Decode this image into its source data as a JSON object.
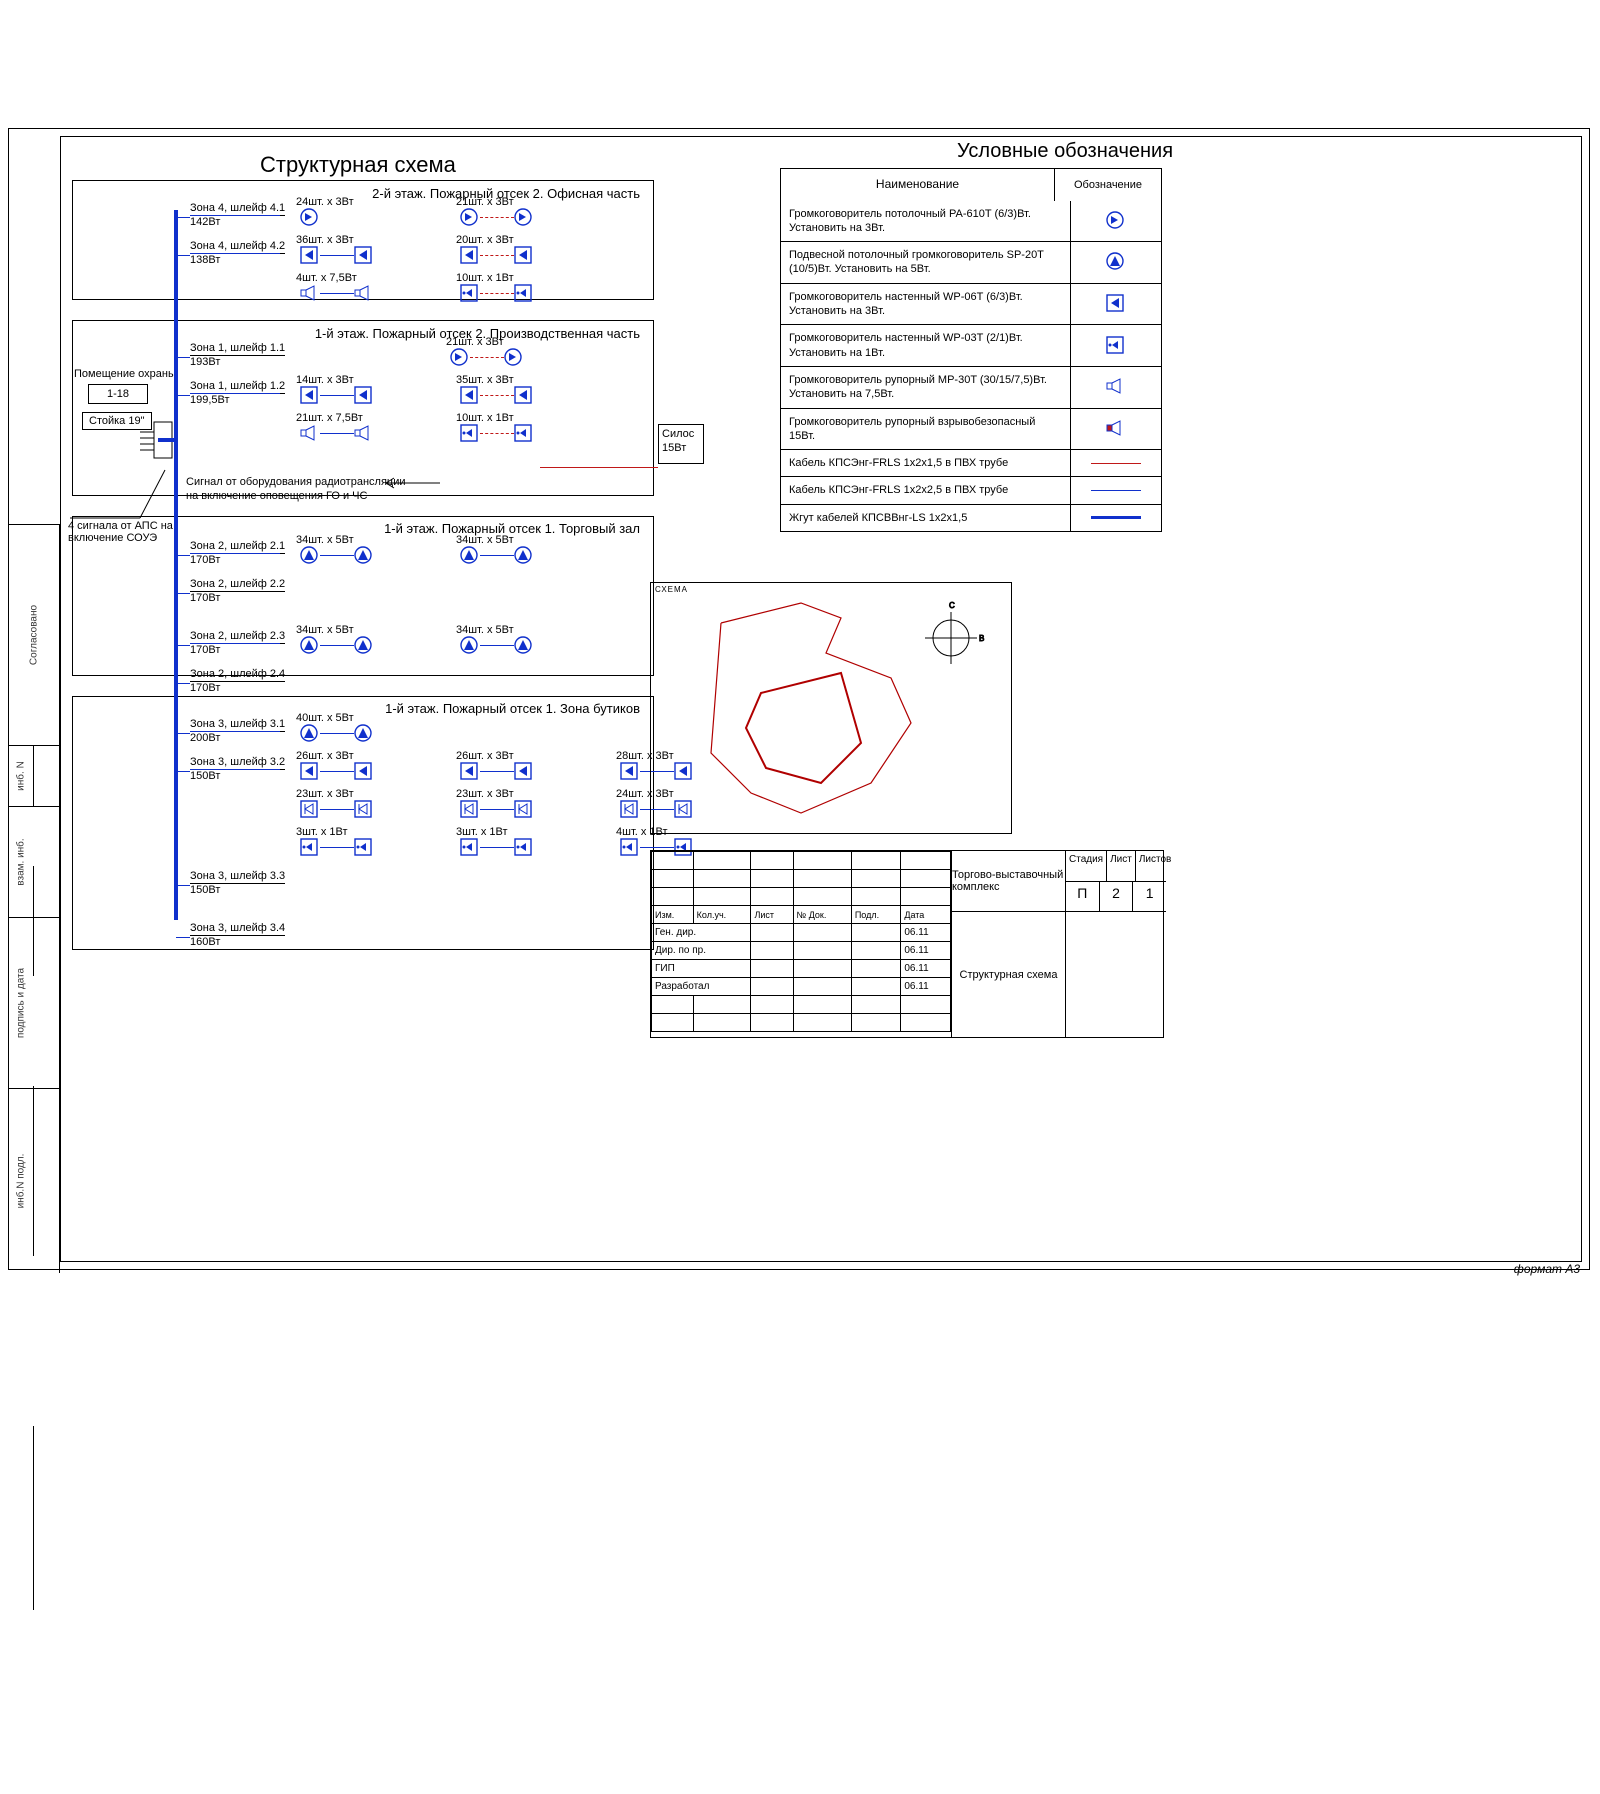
{
  "title": "Структурная схема",
  "legend_title": "Условные обозначения",
  "format": "формат A3",
  "margin_labels": [
    "Согласовано",
    "инб. N",
    "взам. инб.",
    "подпись и дата",
    "инб.N подл."
  ],
  "guard": {
    "room": "Помещение охраны",
    "cells": "1-18",
    "rack": "Стойка 19\"",
    "signals_aps": "4 сигнала от АПС на включение СОУЭ",
    "radio1": "Сигнал от оборудования радиотрансляции",
    "radio2": "на включение оповещения ГО и ЧС"
  },
  "silo": {
    "label": "Силос",
    "power": "15Вт"
  },
  "sections": [
    {
      "title": "2-й этаж. Пожарный отсек 2. Офисная часть",
      "loops": [
        {
          "name": "Зона 4, шлейф 4.1",
          "power": "142Вт",
          "groups": [
            {
              "q": "24шт. x 3Вт",
              "icon": "ceiling",
              "count": 1
            },
            {
              "q": "21шт. x 3Вт",
              "icon": "ceiling",
              "count": 2
            }
          ]
        },
        {
          "name": "Зона 4, шлейф 4.2",
          "power": "138Вт",
          "groups": [
            {
              "q": "36шт. x 3Вт",
              "icon": "wall06",
              "count": 2
            },
            {
              "q": "20шт. x 3Вт",
              "icon": "wall06",
              "count": 2
            }
          ]
        },
        {
          "name": "",
          "power": "",
          "groups": [
            {
              "q": "4шт. x 7,5Вт",
              "icon": "horn",
              "count": 2
            },
            {
              "q": "10шт. x 1Вт",
              "icon": "wall03",
              "count": 2
            }
          ]
        }
      ]
    },
    {
      "title": "1-й этаж. Пожарный отсек 2. Производственная часть",
      "loops": [
        {
          "name": "Зона 1, шлейф 1.1",
          "power": "193Вт",
          "groups": [
            {
              "q": "",
              "icon": "none",
              "count": 0
            },
            {
              "q": "21шт. x 3Вт",
              "icon": "ceiling",
              "count": 2
            }
          ]
        },
        {
          "name": "Зона 1, шлейф 1.2",
          "power": "199,5Вт",
          "groups": [
            {
              "q": "14шт. x 3Вт",
              "icon": "wall06",
              "count": 2
            },
            {
              "q": "35шт. x 3Вт",
              "icon": "wall06",
              "count": 2
            }
          ]
        },
        {
          "name": "",
          "power": "",
          "groups": [
            {
              "q": "21шт. x 7,5Вт",
              "icon": "horn",
              "count": 2
            },
            {
              "q": "10шт. x 1Вт",
              "icon": "wall03",
              "count": 2
            }
          ]
        }
      ]
    },
    {
      "title": "1-й этаж. Пожарный отсек 1. Торговый зал",
      "loops": [
        {
          "name": "Зона 2, шлейф 2.1",
          "power": "170Вт",
          "groups": [
            {
              "q": "34шт. x 5Вт",
              "icon": "pendant",
              "count": 2
            },
            {
              "q": "34шт. x 5Вт",
              "icon": "pendant",
              "count": 2
            }
          ]
        },
        {
          "name": "Зона 2, шлейф 2.2",
          "power": "170Вт",
          "groups": []
        },
        {
          "name": "Зона 2, шлейф 2.3",
          "power": "170Вт",
          "groups": [
            {
              "q": "34шт. x 5Вт",
              "icon": "pendant",
              "count": 2
            },
            {
              "q": "34шт. x 5Вт",
              "icon": "pendant",
              "count": 2
            }
          ]
        },
        {
          "name": "Зона 2, шлейф 2.4",
          "power": "170Вт",
          "groups": []
        }
      ]
    },
    {
      "title": "1-й этаж. Пожарный отсек 1. Зона бутиков",
      "loops": [
        {
          "name": "Зона 3, шлейф 3.1",
          "power": "200Вт",
          "groups": [
            {
              "q": "40шт. x 5Вт",
              "icon": "pendant",
              "count": 2
            }
          ]
        },
        {
          "name": "Зона 3, шлейф 3.2",
          "power": "150Вт",
          "groups": [
            {
              "q": "26шт. x 3Вт",
              "icon": "wall06",
              "count": 2
            },
            {
              "q": "26шт. x 3Вт",
              "icon": "wall06",
              "count": 2
            },
            {
              "q": "28шт. x 3Вт",
              "icon": "wall06",
              "count": 2
            }
          ]
        },
        {
          "name": "",
          "power": "",
          "groups": [
            {
              "q": "23шт. x 3Вт",
              "icon": "wall03b",
              "count": 2
            },
            {
              "q": "23шт. x 3Вт",
              "icon": "wall03b",
              "count": 2
            },
            {
              "q": "24шт. x 3Вт",
              "icon": "wall03b",
              "count": 2
            }
          ]
        },
        {
          "name": "",
          "power": "",
          "groups": [
            {
              "q": "3шт. x 1Вт",
              "icon": "wall03",
              "count": 2
            },
            {
              "q": "3шт. x 1Вт",
              "icon": "wall03",
              "count": 2
            },
            {
              "q": "4шт. x 1Вт",
              "icon": "wall03",
              "count": 2
            }
          ]
        },
        {
          "name": "Зона 3, шлейф 3.3",
          "power": "150Вт",
          "groups": []
        },
        {
          "name": "Зона 3, шлейф 3.4",
          "power": "160Вт",
          "groups": []
        }
      ]
    }
  ],
  "legend": {
    "head_name": "Наименование",
    "head_sym": "Обозначение",
    "rows": [
      {
        "text": "Громкоговоритель потолочный PA-610T (6/3)Вт. Установить на 3Вт.",
        "icon": "ceiling"
      },
      {
        "text": "Подвесной потолочный громкоговоритель SP-20T (10/5)Вт. Установить на 5Вт.",
        "icon": "pendant"
      },
      {
        "text": "Громкоговоритель настенный WP-06T (6/3)Вт. Установить на 3Вт.",
        "icon": "wall06"
      },
      {
        "text": "Громкоговоритель настенный WP-03T (2/1)Вт. Установить на 1Вт.",
        "icon": "wall03"
      },
      {
        "text": "Громкоговоритель рупорный MP-30T (30/15/7,5)Вт. Установить на 7,5Вт.",
        "icon": "horn"
      },
      {
        "text": "Громкоговоритель рупорный взрывобезопасный 15Вт.",
        "icon": "hornex"
      },
      {
        "text": "Кабель КПСЭнг-FRLS 1x2x1,5 в ПВХ трубе",
        "icon": "line-red"
      },
      {
        "text": "Кабель КПСЭнг-FRLS 1x2x2,5 в ПВХ трубе",
        "icon": "line-blue"
      },
      {
        "text": "Жгут кабелей КПСВВнг-LS 1x2x1,5",
        "icon": "line-blue-thick"
      }
    ]
  },
  "minimap_label": "СХЕМА",
  "title_block": {
    "cols": [
      "Изм.",
      "Кол.уч.",
      "Лист",
      "№ Док.",
      "Подл.",
      "Дата"
    ],
    "rows": [
      {
        "role": "Ген. дир.",
        "date": "06.11"
      },
      {
        "role": "Дир. по пр.",
        "date": "06.11"
      },
      {
        "role": "ГИП",
        "date": "06.11"
      },
      {
        "role": "Разработал",
        "date": "06.11"
      }
    ],
    "project": "Торгово-выставочный комплекс",
    "doc": "Структурная схема",
    "stage_h": "Стадия",
    "sheet_h": "Лист",
    "sheets_h": "Листов",
    "stage": "П",
    "sheet": "2",
    "sheets": "1"
  }
}
